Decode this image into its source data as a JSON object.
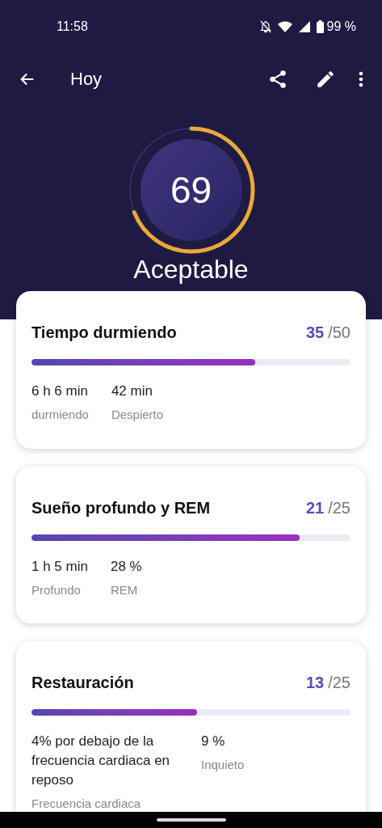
{
  "status_bar": {
    "time": "11:58",
    "battery": "99 %"
  },
  "app_bar": {
    "title": "Hoy"
  },
  "score": {
    "value": "69",
    "level": 0.69,
    "rating": "Aceptable"
  },
  "cards": [
    {
      "title": "Tiempo durmiendo",
      "score": "35",
      "max": "/50",
      "level": 0.7,
      "stats": [
        {
          "value": "6 h 6 min",
          "label": "durmiendo"
        },
        {
          "value": "42 min",
          "label": "Despierto"
        }
      ]
    },
    {
      "title": "Sueño profundo y REM",
      "score": "21",
      "max": "/25",
      "level": 0.84,
      "stats": [
        {
          "value": "1 h 5 min",
          "label": "Profundo"
        },
        {
          "value": "28 %",
          "label": "REM"
        }
      ]
    },
    {
      "title": "Restauración",
      "score": "13",
      "max": "/25",
      "level": 0.52,
      "stats": [
        {
          "value": "4% por debajo de la frecuencia cardiaca en reposo",
          "label": "Frecuencia cardiaca"
        },
        {
          "value": "9 %",
          "label": "Inquieto"
        }
      ]
    }
  ]
}
